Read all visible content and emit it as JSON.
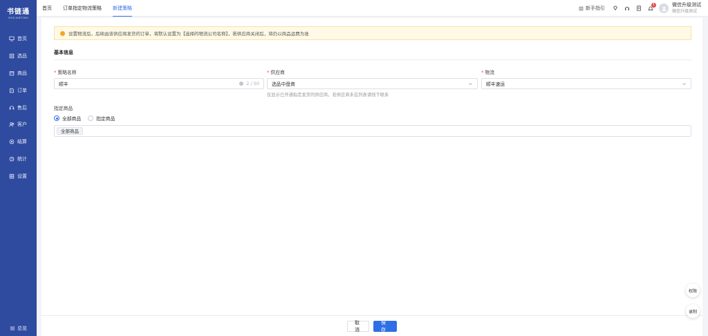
{
  "brand": {
    "name": "书链通",
    "sub": "SHULIANTONG"
  },
  "nav": {
    "items": [
      {
        "label": "首页",
        "icon": "monitor-icon"
      },
      {
        "label": "选品",
        "icon": "picklist-icon"
      },
      {
        "label": "商品",
        "icon": "goods-icon"
      },
      {
        "label": "订单",
        "icon": "order-icon"
      },
      {
        "label": "售后",
        "icon": "aftersale-icon"
      },
      {
        "label": "客户",
        "icon": "customer-icon"
      },
      {
        "label": "结算",
        "icon": "settle-icon"
      },
      {
        "label": "统计",
        "icon": "stats-icon"
      },
      {
        "label": "设置",
        "icon": "settings-icon"
      }
    ],
    "bottom_label": "总览"
  },
  "tabs": [
    {
      "label": "首页",
      "active": false
    },
    {
      "label": "订单指定物流策略",
      "active": false
    },
    {
      "label": "新建策略",
      "active": true
    }
  ],
  "topbar": {
    "guide_label": "新手指引",
    "notification_count": "1",
    "user_name": "微信升级测试",
    "user_sub": "微信升级测试"
  },
  "notice": "设置物流后，后续由该供应商发货的订单，将默认设置为【选择的物流公司名称】，若供应商关闭后，将仍以商品运费为准",
  "form": {
    "section_title": "基本信息",
    "strategy_name": {
      "label": "策略名称",
      "value": "顺丰",
      "count": "2 / 50"
    },
    "supplier": {
      "label": "供应商",
      "value": "选品中盘商",
      "hint": "仅显示已开通指定发货的供应商，若供应商未在列表请线下联系"
    },
    "logistics": {
      "label": "物流",
      "value": "顺丰速运"
    },
    "goods": {
      "label": "指定商品",
      "options": [
        {
          "label": "全部商品",
          "checked": true
        },
        {
          "label": "指定商品",
          "checked": false
        }
      ],
      "selected_tag": "全部商品"
    }
  },
  "footer": {
    "cancel_label": "取 消",
    "save_label": "保 存"
  },
  "floating": {
    "permission_label": "权限",
    "record_label": "录制"
  },
  "colors": {
    "sidebar": "#2f4ba0",
    "accent": "#2f6fe6",
    "required": "#e84848",
    "notice_bg": "#fff9e6"
  }
}
